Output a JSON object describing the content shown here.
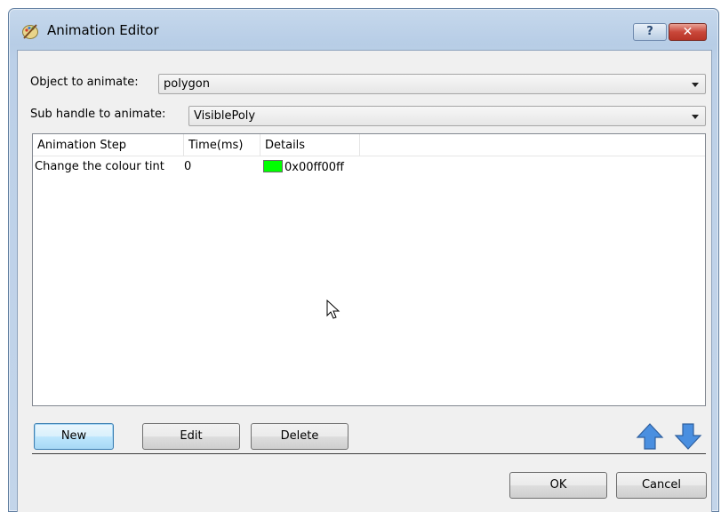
{
  "window": {
    "title": "Animation Editor",
    "help_label": "?",
    "close_label": "✕"
  },
  "object_row": {
    "label": "Object to animate:",
    "value": "polygon"
  },
  "subhandle_row": {
    "label": "Sub handle to animate:",
    "value": "VisiblePoly"
  },
  "table": {
    "columns": [
      "Animation Step",
      "Time(ms)",
      "Details"
    ],
    "rows": [
      {
        "step": "Change the colour tint",
        "time": "0",
        "details": "0x00ff00ff",
        "swatch_color": "#00ff00"
      }
    ]
  },
  "buttons": {
    "new": "New",
    "edit": "Edit",
    "delete": "Delete",
    "ok": "OK",
    "cancel": "Cancel"
  },
  "icons": {
    "app": "painter-palette-icon",
    "move_up": "arrow-up-icon",
    "move_down": "arrow-down-icon",
    "arrow_color": "#4a8fe0"
  }
}
